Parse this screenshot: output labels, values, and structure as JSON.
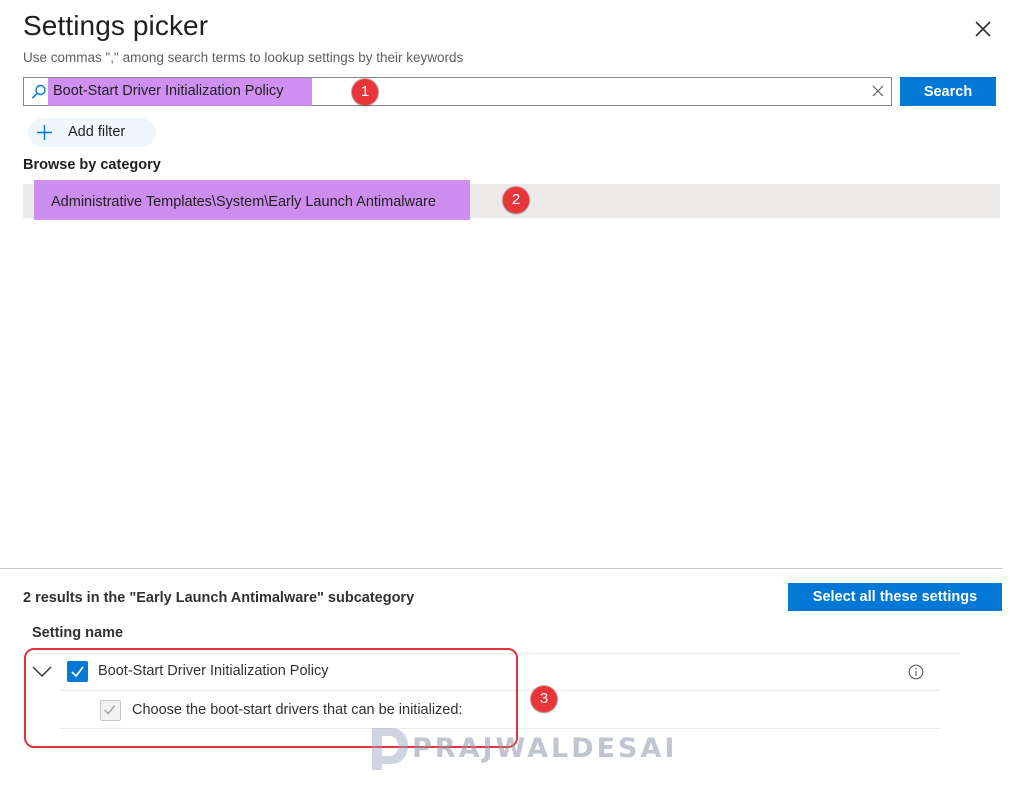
{
  "panel": {
    "title": "Settings picker",
    "subtitle": "Use commas \",\" among search terms to lookup settings by their keywords"
  },
  "search": {
    "value": "Boot-Start Driver Initialization Policy",
    "button_label": "Search"
  },
  "filter": {
    "add_label": "Add filter"
  },
  "browse": {
    "label": "Browse by category",
    "category": "Administrative Templates\\System\\Early Launch Antimalware"
  },
  "results": {
    "summary": "2 results in the \"Early Launch Antimalware\" subcategory",
    "select_all_label": "Select all these settings",
    "column_header": "Setting name",
    "rows": [
      {
        "name": "Boot-Start Driver Initialization Policy",
        "checked": true
      },
      {
        "name": "Choose the boot-start drivers that can be initialized:",
        "checked": true,
        "disabled": true
      }
    ]
  },
  "annotations": [
    "1",
    "2",
    "3"
  ],
  "watermark": {
    "text": "PRAJWALDESAI"
  },
  "colors": {
    "accent": "#0078d4",
    "highlight": "#c77df0",
    "badge": "#e8353a",
    "category_bg": "#edebe9"
  }
}
